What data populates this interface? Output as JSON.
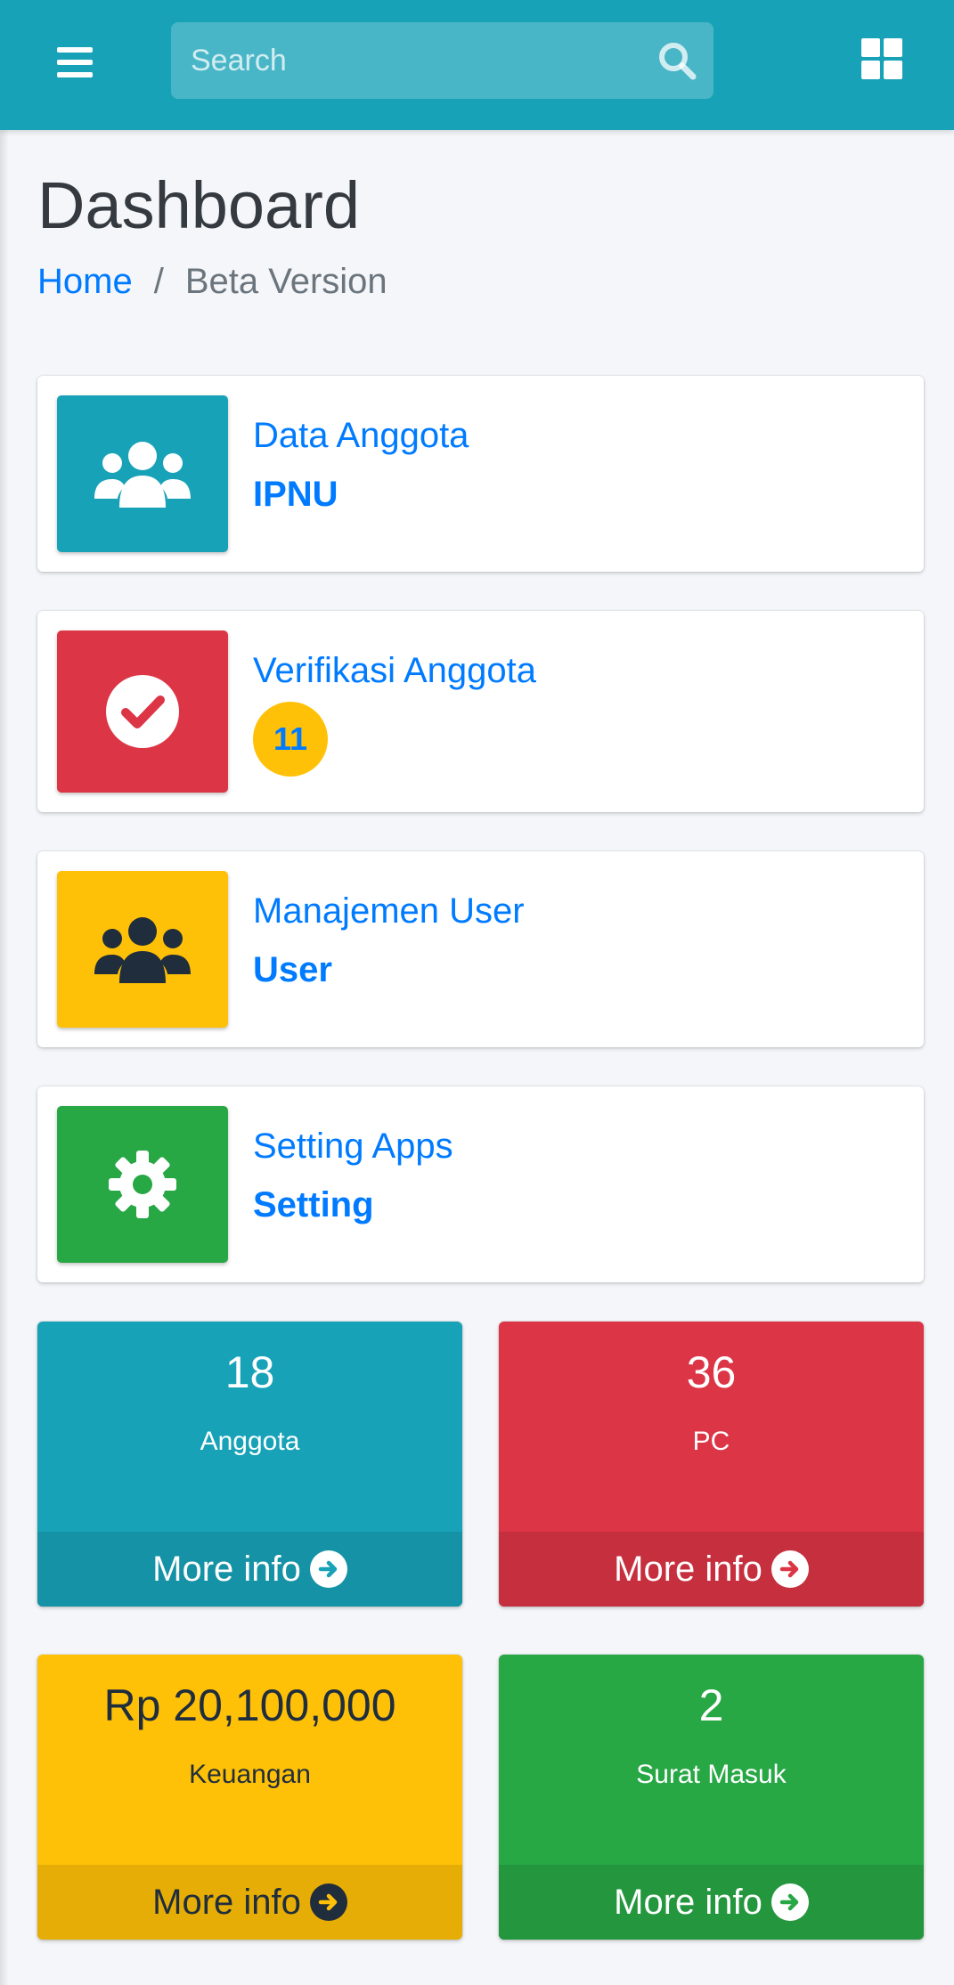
{
  "navbar": {
    "search_placeholder": "Search"
  },
  "header": {
    "title": "Dashboard",
    "breadcrumb": {
      "home": "Home",
      "separator": "/",
      "current": "Beta Version"
    }
  },
  "info_boxes": [
    {
      "label": "Data Anggota",
      "value": "IPNU",
      "icon": "users-icon",
      "color": "#17a2b8"
    },
    {
      "label": "Verifikasi Anggota",
      "badge": "11",
      "icon": "check-circle-icon",
      "color": "#dc3545"
    },
    {
      "label": "Manajemen User",
      "value": "User",
      "icon": "users-icon",
      "color": "#ffc107"
    },
    {
      "label": "Setting Apps",
      "value": "Setting",
      "icon": "gear-icon",
      "color": "#28a745"
    }
  ],
  "small_boxes": [
    {
      "value": "18",
      "label": "Anggota",
      "footer": "More info",
      "color": "#17a2b8",
      "footer_color": "#1592a6",
      "text_color": "#ffffff"
    },
    {
      "value": "36",
      "label": "PC",
      "footer": "More info",
      "color": "#dc3545",
      "footer_color": "#c6303e",
      "text_color": "#ffffff"
    },
    {
      "value": "Rp 20,100,000",
      "label": "Keuangan",
      "footer": "More info",
      "color": "#ffc107",
      "footer_color": "#e5ad06",
      "text_color": "#1f2d3d"
    },
    {
      "value": "2",
      "label": "Surat Masuk",
      "footer": "More info",
      "color": "#28a745",
      "footer_color": "#24963e",
      "text_color": "#ffffff"
    }
  ]
}
